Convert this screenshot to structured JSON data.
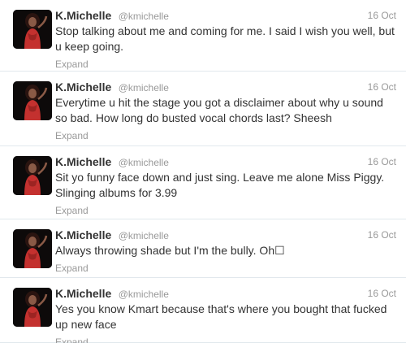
{
  "tweets": [
    {
      "fullname": "K.Michelle",
      "username": "@kmichelle",
      "time": "16 Oct",
      "text": "Stop talking about me and coming for me. I said I wish you well, but u keep going.",
      "expand": "Expand",
      "avatar_icon": "profile-photo"
    },
    {
      "fullname": "K.Michelle",
      "username": "@kmichelle",
      "time": "16 Oct",
      "text": "Everytime u hit the stage you got a disclaimer about why u sound so bad. How long do busted vocal chords last? Sheesh",
      "expand": "Expand",
      "avatar_icon": "profile-photo"
    },
    {
      "fullname": "K.Michelle",
      "username": "@kmichelle",
      "time": "16 Oct",
      "text": "Sit yo funny face down and just sing. Leave me alone Miss Piggy. Slinging albums for 3.99",
      "expand": "Expand",
      "avatar_icon": "profile-photo"
    },
    {
      "fullname": "K.Michelle",
      "username": "@kmichelle",
      "time": "16 Oct",
      "text": "Always throwing shade but I'm the bully. Oh☐",
      "expand": "Expand",
      "avatar_icon": "profile-photo"
    },
    {
      "fullname": "K.Michelle",
      "username": "@kmichelle",
      "time": "16 Oct",
      "text": "Yes you know Kmart because that's where you bought that fucked up new face",
      "expand": "Expand",
      "avatar_icon": "profile-photo"
    }
  ],
  "colors": {
    "name": "#333333",
    "muted": "#999999",
    "divider": "#e1e8ed",
    "avatar_bg": "#0d0a0a",
    "avatar_figure": "#c4312f"
  }
}
